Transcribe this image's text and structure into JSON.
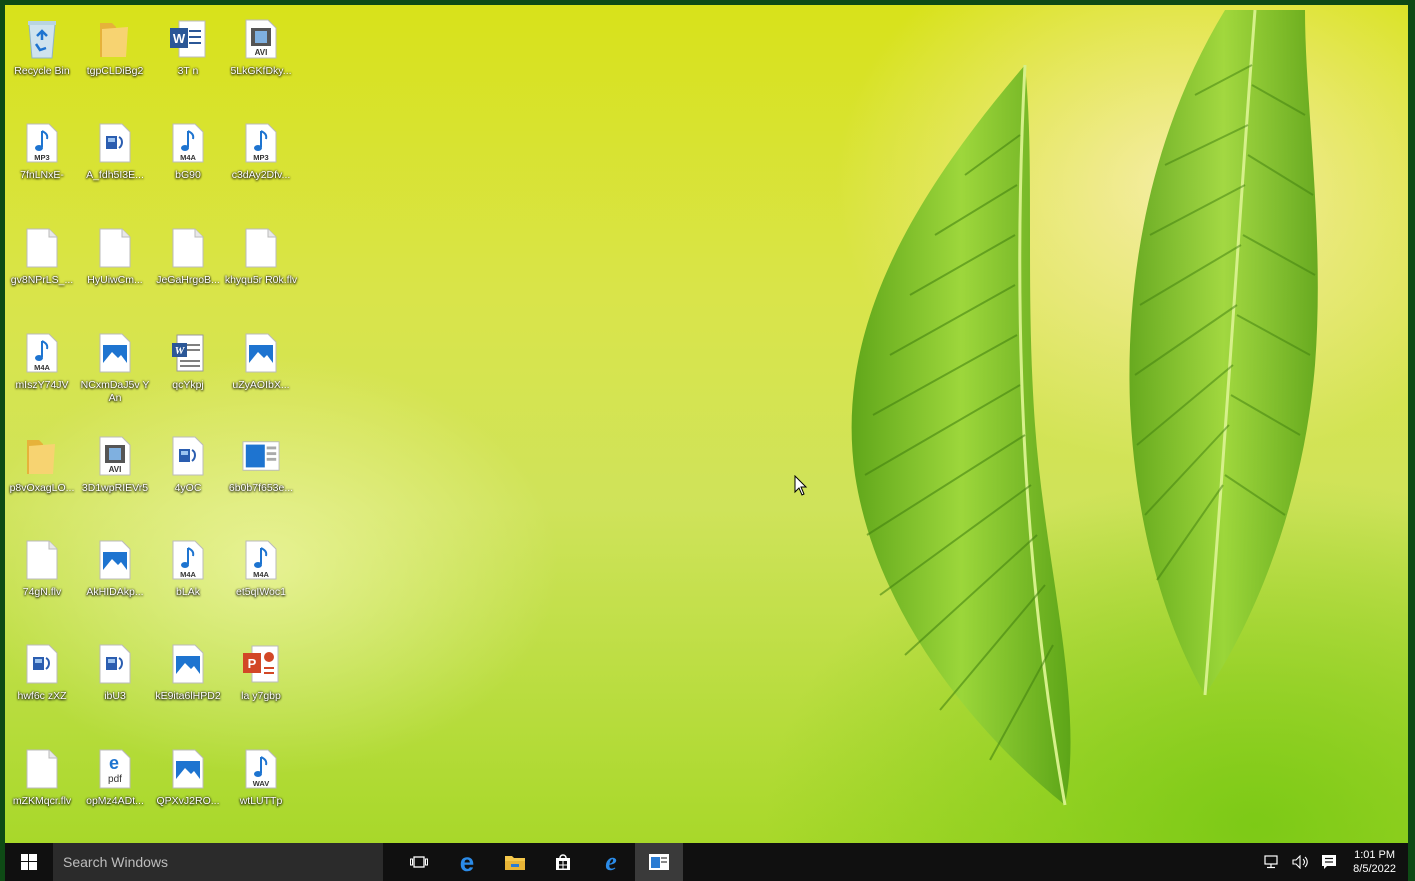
{
  "desktop": {
    "icons": [
      {
        "label": "Recycle Bin",
        "type": "recycle"
      },
      {
        "label": "7fnLNxE-",
        "type": "mp3"
      },
      {
        "label": "gv8NPrLS_...",
        "type": "blank"
      },
      {
        "label": "mIszY74JV",
        "type": "m4a"
      },
      {
        "label": "p8vOxagLO...",
        "type": "folder"
      },
      {
        "label": "74gN.flv",
        "type": "blank"
      },
      {
        "label": "hwf6c zXZ",
        "type": "video"
      },
      {
        "label": "mZKMqcr.flv",
        "type": "blank"
      },
      {
        "label": "tgpCLDiBg2",
        "type": "folder"
      },
      {
        "label": "A_fdh5I3E...",
        "type": "video"
      },
      {
        "label": "HyUiwCm...",
        "type": "blank"
      },
      {
        "label": "NCxmDaJ5v YAn",
        "type": "image"
      },
      {
        "label": "3D1wpRIEVr5",
        "type": "avi"
      },
      {
        "label": "AkHIDAkp...",
        "type": "image"
      },
      {
        "label": "ibU3",
        "type": "video"
      },
      {
        "label": "opMz4ADt...",
        "type": "pdf"
      },
      {
        "label": "3T n",
        "type": "word"
      },
      {
        "label": "bG90",
        "type": "m4a"
      },
      {
        "label": "JeGaHrgoB...",
        "type": "blank"
      },
      {
        "label": "qcYkpj",
        "type": "worddoc"
      },
      {
        "label": "4yOC",
        "type": "video"
      },
      {
        "label": "bLAk",
        "type": "m4a"
      },
      {
        "label": "kE9ita6lHPD2",
        "type": "image"
      },
      {
        "label": "QPXvJ2RO...",
        "type": "image"
      },
      {
        "label": "5LkGKfDky...",
        "type": "avi"
      },
      {
        "label": "c3dAy2Dfv...",
        "type": "mp3"
      },
      {
        "label": "khyqu5r R0k.flv",
        "type": "blank"
      },
      {
        "label": "uZyAOIbX...",
        "type": "image"
      },
      {
        "label": "6b0b7f653e...",
        "type": "app"
      },
      {
        "label": "et5qIWoc1",
        "type": "m4a"
      },
      {
        "label": "la y7gbp",
        "type": "ppt"
      },
      {
        "label": "wtLUTTp",
        "type": "wav"
      }
    ]
  },
  "taskbar": {
    "search_placeholder": "Search Windows",
    "apps": [
      {
        "name": "task-view",
        "icon": "task-view-icon"
      },
      {
        "name": "edge",
        "icon": "edge-icon"
      },
      {
        "name": "file-explorer",
        "icon": "folder-icon"
      },
      {
        "name": "store",
        "icon": "store-icon"
      },
      {
        "name": "internet-explorer",
        "icon": "ie-icon"
      },
      {
        "name": "active-window",
        "icon": "window-icon"
      }
    ],
    "clock_time": "1:01 PM",
    "clock_date": "8/5/2022"
  },
  "colors": {
    "taskbar_bg": "#101010",
    "search_bg": "#2b2b2b",
    "accent_blue": "#0078d7"
  }
}
